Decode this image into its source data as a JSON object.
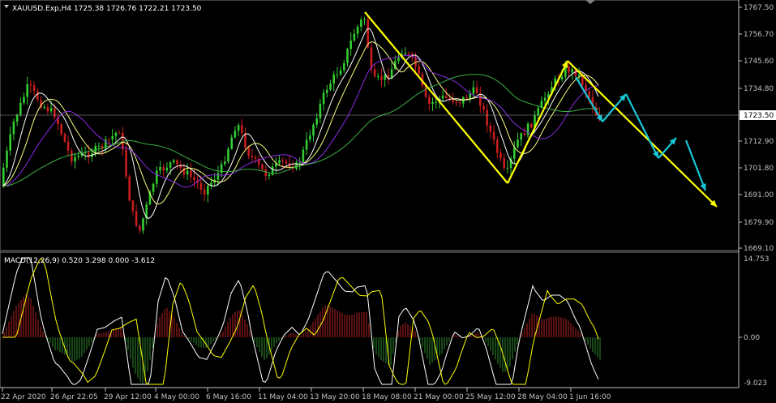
{
  "window": {
    "symbol_info": "XAUUSD.Exp,H4  1725.38 1726.76 1722.21 1723.50",
    "macd_info": "MACD(12,26,9) 0.520 3.298 0.000 -3.612",
    "current_price": "1723.50"
  },
  "price_axis": [
    "1767.50",
    "1756.70",
    "1745.60",
    "1734.80",
    "1712.90",
    "1701.80",
    "1691.00",
    "1679.90",
    "1669.10"
  ],
  "macd_axis": [
    "14.753",
    "0.00",
    "-9.023"
  ],
  "time_axis": [
    "22 Apr 2020",
    "26 Apr 22:05",
    "29 Apr 12:00",
    "4 May 00:00",
    "6 May 16:00",
    "11 May 04:00",
    "13 May 20:00",
    "18 May 08:00",
    "21 May 00:00",
    "25 May 12:00",
    "28 May 04:00",
    "1 Jun 16:00"
  ],
  "colors": {
    "background": "#000000",
    "bull": "#32CD32",
    "bear": "#C81E1E",
    "trend_yellow": "#FFFF00",
    "trend_cyan": "#17C7D8",
    "ma_fast": "#FFFFFF",
    "ma_mid": "#FFFF80",
    "ma_slow": "#8A2BE2",
    "ma_long": "#3CB043",
    "axis": "#C0C0C0"
  }
}
